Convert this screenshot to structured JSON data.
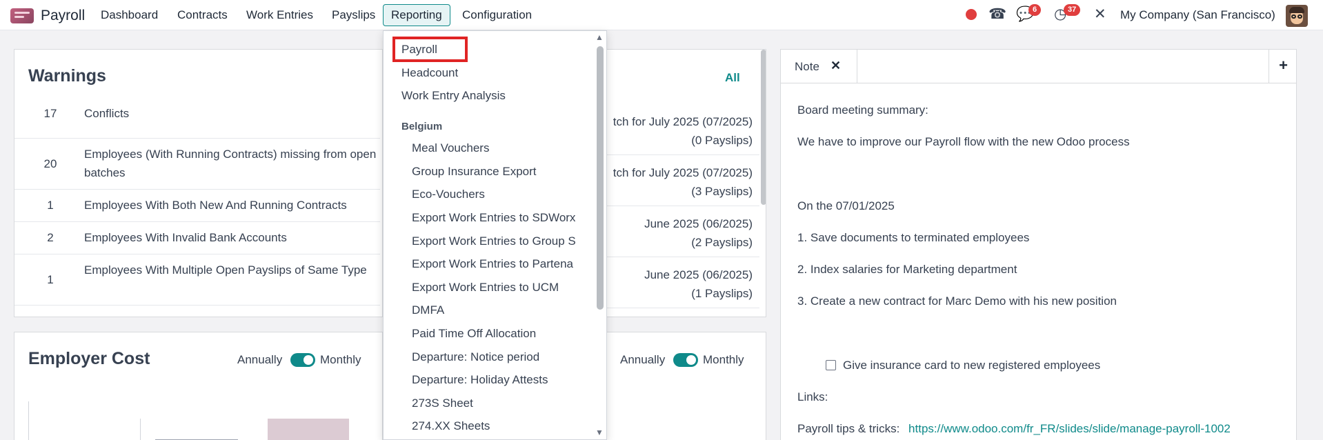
{
  "navbar": {
    "app_name": "Payroll",
    "menu": [
      "Dashboard",
      "Contracts",
      "Work Entries",
      "Payslips",
      "Reporting",
      "Configuration"
    ],
    "messages_badge": "6",
    "activities_badge": "37",
    "company": "My Company (San Francisco)"
  },
  "warnings": {
    "title": "Warnings",
    "rows": [
      {
        "count": "17",
        "label": "Conflicts"
      },
      {
        "count": "20",
        "label": "Employees (With Running Contracts) missing from open batches"
      },
      {
        "count": "1",
        "label": "Employees With Both New And Running Contracts"
      },
      {
        "count": "2",
        "label": "Employees With Invalid Bank Accounts"
      },
      {
        "count": "1",
        "label": "Employees With Multiple Open Payslips of Same Type"
      }
    ]
  },
  "batches": {
    "all_link": "All",
    "rows": [
      {
        "line1": "tch for July 2025 (07/2025)",
        "line2": "(0 Payslips)"
      },
      {
        "line1": "tch for July 2025 (07/2025)",
        "line2": "(3 Payslips)"
      },
      {
        "line1": "June 2025 (06/2025)",
        "line2": "(2 Payslips)"
      },
      {
        "line1": "June 2025 (06/2025)",
        "line2": "(1 Payslips)"
      }
    ]
  },
  "employer_cost": {
    "title": "Employer Cost",
    "annually": "Annually",
    "monthly": "Monthly"
  },
  "second_toggle": {
    "annually": "Annually",
    "monthly": "Monthly"
  },
  "note": {
    "tab_label": "Note",
    "lines": [
      "Board meeting summary:",
      "We have to improve our Payroll flow with the new Odoo process",
      "On the 07/01/2025",
      "1. Save documents to terminated employees",
      "2. Index salaries for Marketing department",
      "3. Create a new contract for Marc Demo with his new position"
    ],
    "checkbox_label": "Give insurance card to new registered employees",
    "links_label": "Links:",
    "tips_label": "Payroll tips & tricks:",
    "tips_url": "https://www.odoo.com/fr_FR/slides/slide/manage-payroll-1002"
  },
  "reporting_menu": {
    "top_items": [
      "Payroll",
      "Headcount",
      "Work Entry Analysis"
    ],
    "section": "Belgium",
    "belgium_items": [
      "Meal Vouchers",
      "Group Insurance Export",
      "Eco-Vouchers",
      "Export Work Entries to SDWorx",
      "Export Work Entries to Group S",
      "Export Work Entries to Partena",
      "Export Work Entries to UCM",
      "DMFA",
      "Paid Time Off Allocation",
      "Departure: Notice period",
      "Departure: Holiday Attests",
      "273S Sheet",
      "274.XX Sheets"
    ]
  },
  "colors": {
    "accent": "#0f8a8a",
    "badge": "#e03e3e",
    "highlight": "#e02424"
  }
}
